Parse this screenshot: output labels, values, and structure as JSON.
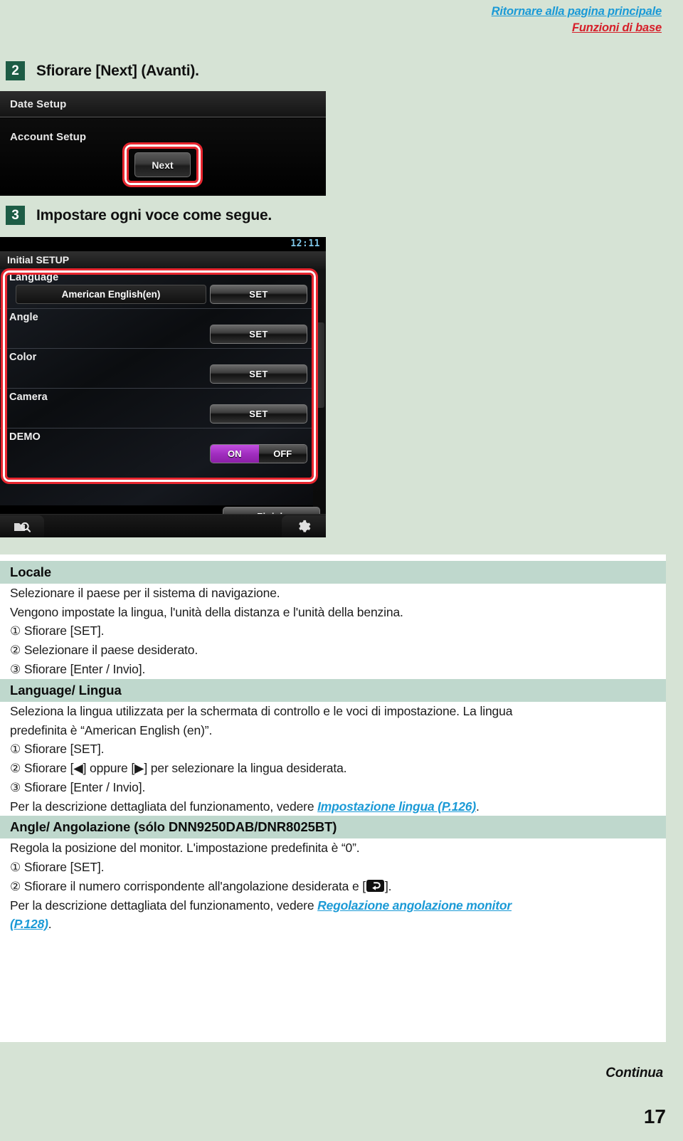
{
  "header": {
    "home_link": "Ritornare alla pagina principale",
    "section_link": "Funzioni di base"
  },
  "steps": [
    {
      "number": "2",
      "text": "Sfiorare [Next] (Avanti)."
    },
    {
      "number": "3",
      "text": "Impostare ogni voce come segue."
    }
  ],
  "device_screen_1": {
    "rows": [
      {
        "label": "Date Setup"
      },
      {
        "label": "Account Setup"
      }
    ],
    "next_button": "Next",
    "highlight_color": "#e8262f"
  },
  "device_screen_2": {
    "clock": "12:11",
    "title": "Initial SETUP",
    "rows": [
      {
        "label": "Language",
        "value": "American English(en)",
        "action": "SET"
      },
      {
        "label": "Angle",
        "value": "",
        "action": "SET"
      },
      {
        "label": "Color",
        "value": "",
        "action": "SET"
      },
      {
        "label": "Camera",
        "value": "",
        "action": "SET"
      },
      {
        "label": "DEMO",
        "value": "",
        "action": "toggle",
        "on": "ON",
        "off": "OFF",
        "selected": "ON"
      }
    ],
    "finish_button": "Finish",
    "bottom_left_icon": "folder-search-icon",
    "bottom_right_icon": "gear-icon",
    "active_toggle_color": "#a12ec0"
  },
  "sections": [
    {
      "title": "Locale",
      "lines": [
        "Selezionare il paese per il sistema di navigazione.",
        "Vengono impostate la lingua, l'unità della distanza e l'unità della benzina."
      ],
      "steps": [
        {
          "num": "①",
          "text": "Sfiorare [SET]."
        },
        {
          "num": "②",
          "text": "Selezionare il paese desiderato."
        },
        {
          "num": "③",
          "text": "Sfiorare [Enter / Invio]."
        }
      ]
    },
    {
      "title": "Language/ Lingua",
      "lines": [
        "Seleziona la lingua utilizzata per la schermata di controllo e le voci di impostazione. La lingua",
        "predefinita è “American English (en)”."
      ],
      "steps": [
        {
          "num": "①",
          "text": "Sfiorare [SET]."
        },
        {
          "num": "②",
          "text": "Sfiorare [◀] oppure [▶] per selezionare la lingua desiderata."
        },
        {
          "num": "③",
          "text": "Sfiorare [Enter / Invio]."
        }
      ],
      "reference_prefix": "Per la descrizione dettagliata del funzionamento, vedere ",
      "reference_link": "Impostazione lingua (P.126)",
      "reference_suffix": "."
    },
    {
      "title": "Angle/ Angolazione (sólo DNN9250DAB/DNR8025BT)",
      "lines": [
        "Regola la posizione del monitor. L'impostazione predefinita è “0”."
      ],
      "steps": [
        {
          "num": "①",
          "text": "Sfiorare [SET]."
        },
        {
          "num": "②",
          "text": "Sfiorare il numero corrispondente all'angolazione desiderata e [ ]."
        }
      ],
      "step2_prefix": "Sfiorare il numero corrispondente all'angolazione desiderata e [",
      "step2_suffix": "].",
      "step2_icon": "return-arrow-icon",
      "reference_prefix": "Per la descrizione dettagliata del funzionamento, vedere ",
      "reference_link_line1": "Regolazione angolazione monitor",
      "reference_link_line2": "(P.128)",
      "reference_suffix": "."
    }
  ],
  "footer": {
    "continued": "Continua",
    "page_number": "17"
  }
}
